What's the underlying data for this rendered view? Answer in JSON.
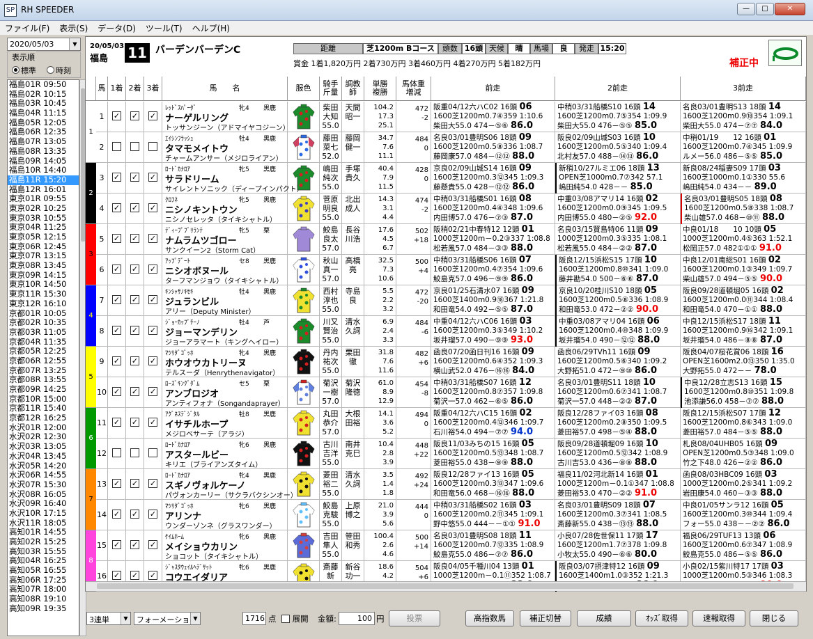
{
  "window": {
    "title": "RH SPEEDER",
    "app_icon": "SP"
  },
  "menu": [
    "ファイル(F)",
    "表示(S)",
    "データ(D)",
    "ツール(T)",
    "ヘルプ(H)"
  ],
  "sidebar": {
    "date": "2020/05/03",
    "order_label": "表示順",
    "order_std": "標準",
    "order_time": "時刻",
    "races": [
      "福島01R 09:50",
      "福島02R 10:15",
      "福島03R 10:45",
      "福島04R 11:15",
      "福島05R 12:05",
      "福島06R 12:35",
      "福島07R 13:05",
      "福島08R 13:35",
      "福島09R 14:05",
      "福島10R 14:40",
      "福島11R 15:20",
      "福島12R 16:01",
      "東京01R 09:55",
      "東京02R 10:25",
      "東京03R 10:55",
      "東京04R 11:25",
      "東京05R 12:15",
      "東京06R 12:45",
      "東京07R 13:15",
      "東京08R 13:45",
      "東京09R 14:15",
      "東京10R 14:50",
      "東京11R 15:30",
      "東京12R 16:10",
      "京都01R 10:05",
      "京都02R 10:35",
      "京都03R 11:05",
      "京都04R 11:35",
      "京都05R 12:25",
      "京都06R 12:55",
      "京都07R 13:25",
      "京都08R 13:55",
      "京都09R 14:25",
      "京都10R 15:00",
      "京都11R 15:40",
      "京都12R 16:25",
      "水沢01R 12:00",
      "水沢02R 12:30",
      "水沢03R 13:05",
      "水沢04R 13:45",
      "水沢05R 14:20",
      "水沢06R 14:55",
      "水沢07R 15:30",
      "水沢08R 16:05",
      "水沢09R 16:40",
      "水沢10R 17:15",
      "水沢11R 18:05",
      "高知01R 14:55",
      "高知02R 15:25",
      "高知03R 15:55",
      "高知04R 16:25",
      "高知05R 16:55",
      "高知06R 17:25",
      "高知07R 18:00",
      "高知08R 19:10",
      "高知09R 19:35"
    ],
    "selected_index": 10
  },
  "race": {
    "date": "20/05/03",
    "venue": "福島",
    "number": "11",
    "name": "バーデンバーデンC",
    "dist_label": "距離",
    "course": "芝1200m Bコース",
    "heads_label": "頭数",
    "heads": "16頭",
    "weather_label": "天候",
    "weather": "晴",
    "track_label": "馬場",
    "track": "良",
    "post_label": "発走",
    "post": "15:20",
    "prize": "賞金 1着1,820万円 2着730万円 3着460万円 4着270万円 5着182万円",
    "hosei": "補正中"
  },
  "columns": {
    "num": "馬",
    "c1": "1着",
    "c2": "2着",
    "c3": "3着",
    "name": "馬　　名",
    "color": "服色",
    "jockey": "騎手\n斤量",
    "trainer": "調教\n師",
    "odds": "単勝\n複勝",
    "weight": "馬体重\n増減",
    "p1": "前走",
    "p2": "2前走",
    "p3": "3前走"
  },
  "brackets": [
    {
      "n": "1",
      "color": "#ffffff",
      "fg": "#000000"
    },
    {
      "n": "2",
      "color": "#000000",
      "fg": "#ffffff"
    },
    {
      "n": "3",
      "color": "#ff0000",
      "fg": "#000000"
    },
    {
      "n": "4",
      "color": "#0000ff",
      "fg": "#ffff00"
    },
    {
      "n": "5",
      "color": "#ffff00",
      "fg": "#000000"
    },
    {
      "n": "6",
      "color": "#009900",
      "fg": "#ffffff"
    },
    {
      "n": "7",
      "color": "#ff8800",
      "fg": "#000000"
    },
    {
      "n": "8",
      "color": "#ff44dd",
      "fg": "#ffffff"
    }
  ],
  "horses": [
    {
      "no": "1",
      "c1": true,
      "c2": true,
      "c3": true,
      "sire": "ﾚｯﾄﾞｽﾊﾟｰﾀﾞ",
      "sex": "牝4",
      "hcol": "黒鹿",
      "name": "ナーゲルリング",
      "dam": "トッサンジーン（アドマイヤコジーン）",
      "jockey": "柴田\n大知\n55.0",
      "trainer": "天間\n昭一",
      "odds": "104.2\n17.3\n25.1",
      "weight": "472\n-2",
      "silk": {
        "body": "#1a8a2a",
        "pat": "#d42020",
        "sleeve": "#1a8a2a",
        "cap": "#1a8a2a"
      },
      "p1": [
        "阪重04/12六ハC02 16頭",
        "06",
        "1600芝1200m0.7④359 1:10.6",
        "柴田大55.0 474－⑤⑥",
        "86.0",
        ""
      ],
      "p2": [
        "中稍03/31船橋S10 16頭",
        "14",
        "1600芝1200m0.7⑤354 1:09.9",
        "柴田大55.0 476－⑤⑤",
        "85.0",
        ""
      ],
      "p3": [
        "名良03/01豊明S13 18頭",
        "14",
        "1600芝1200m0.9⑱354 1:09.1",
        "柴田大55.0 474－⑦⑦",
        "84.0",
        ""
      ],
      "m2": "",
      "m3": ""
    },
    {
      "no": "2",
      "c1": false,
      "c2": false,
      "c3": false,
      "sire": "ｴｲｼﾝﾌﾗｯｼｭ",
      "sex": "牡4",
      "hcol": "黒鹿",
      "name": "タマモメイトウ",
      "dam": "チャームアンサー（メジロライアン）",
      "jockey": "藤田\n菜七\n52.0",
      "trainer": "藤岡\n健一",
      "odds": "34.7\n7.6\n11.1",
      "weight": "484\n0",
      "silk": {
        "body": "#ffffff",
        "pat": "#2b6be8",
        "sleeve": "#d04060",
        "cap": "#2b6be8"
      },
      "p1": [
        "名良03/01豊明S06 18頭",
        "09",
        "1600芝1200m0.5⑧336 1:08.7",
        "藤岡康57.0 484－⑫⑫",
        "88.0",
        ""
      ],
      "p2": [
        "阪良02/09山城S03 16頭",
        "10",
        "1600芝1200m0.5⑤340 1:09.4",
        "北村友57.0 488－⑭⑬",
        "86.0",
        ""
      ],
      "p3": [
        "中稍01/19　　12 16頭",
        "01",
        "1600芝1200m0.7④345 1:09.9",
        "ルメー56.0 486－⑤⑤",
        "85.0",
        ""
      ],
      "m2": "",
      "m3": ""
    },
    {
      "no": "3",
      "c1": true,
      "c2": true,
      "c3": true,
      "sire": "ﾛｰﾄﾞｶﾅﾛｱ",
      "sex": "牝5",
      "hcol": "黒鹿",
      "name": "サラドリーム",
      "dam": "サイレントソニック（ディープインパクト）",
      "jockey": "嶋田\n純次\n55.0",
      "trainer": "手塚\n貴久",
      "odds": "40.4\n7.9\n11.5",
      "weight": "428\n0",
      "silk": {
        "body": "#1a8a2a",
        "pat": "#d42020",
        "sleeve": "#1a8a2a",
        "cap": "#1a8a2a"
      },
      "p1": [
        "京良02/09山城S14 16頭",
        "09",
        "1600芝1200m0.3⑫345 1:09.3",
        "藤懸貴55.0 428－⑫⑫",
        "86.0",
        ""
      ],
      "p2": [
        "新稍10/27ルミエ06 18頭",
        "13",
        "OPEN芝1000m0.7⑦342 57.1",
        "嶋田純54.0 428－－",
        "85.0",
        ""
      ],
      "p3": [
        "新良08/24稲妻S09 17頭",
        "03",
        "1600芝1000m0.1①330 55.6",
        "嶋田純54.0 434－－",
        "89.0",
        ""
      ],
      "m2": "mk",
      "m3": ""
    },
    {
      "no": "4",
      "c1": true,
      "c2": true,
      "c3": true,
      "sire": "ｸﾛﾌﾈ",
      "sex": "牝5",
      "hcol": "黒鹿",
      "name": "ニシノキントウン",
      "dam": "ニシノセレッタ（タイキシャトル）",
      "jockey": "菅原\n明良\n55.0",
      "trainer": "北出\n成人",
      "odds": "14.3\n3.1\n4.4",
      "weight": "474\n-2",
      "silk": {
        "body": "#f0e030",
        "pat": "#4040c0",
        "sleeve": "#f0e030",
        "cap": "#f0e030"
      },
      "p1": [
        "中稍03/31船橋S01 16頭",
        "08",
        "1600芝1200m0.4④348 1:09.6",
        "内田博57.0 476－⑦③",
        "87.0",
        ""
      ],
      "p2": [
        "中重03/08アマリ14 16頭",
        "02",
        "1600芝1200m0.0⑨345 1:09.5",
        "内田博55.0 480－②⑤",
        "92.0",
        "red"
      ],
      "p3": [
        "名良03/01豊明S05 18頭",
        "08",
        "1600芝1200m0.5⑧338 1:08.7",
        "柴山雄57.0 468－⑩⑪",
        "88.0",
        ""
      ],
      "m2": "",
      "m3": "mkr"
    },
    {
      "no": "5",
      "c1": true,
      "c2": true,
      "c3": true,
      "sire": "ﾃﾞｨｰﾌﾟﾌﾞﾘﾗﾝﾃ",
      "sex": "牝5",
      "hcol": "栗",
      "name": "ナムラムツゴロー",
      "dam": "サンクイーン2（Storm Cat）",
      "jockey": "鮫島\n良太\n57.0",
      "trainer": "長谷\n川浩",
      "odds": "17.6\n4.5\n6.7",
      "weight": "502\n+18",
      "silk": {
        "body": "#a08ad8",
        "pat": "#a08ad8",
        "sleeve": "#a08ad8",
        "cap": "#a08ad8"
      },
      "p1": [
        "阪稍02/21中春特12 12頭",
        "01",
        "1000芝1200m－0.2③337 1:08.8",
        "松若風57.0 484－③③",
        "88.0",
        ""
      ],
      "p2": [
        "名良03/15賢島特06 11頭",
        "09",
        "1000芝1200m0.3⑤335 1:08.1",
        "松若風55.0 484－②②",
        "87.0",
        ""
      ],
      "p3": [
        "中良01/18　　10 10頭",
        "05",
        "1000芝1200m0.4⑤363 1:52.1",
        "松岡正57.0 482①①①",
        "91.0",
        "red"
      ],
      "m2": "",
      "m3": ""
    },
    {
      "no": "6",
      "c1": true,
      "c2": true,
      "c3": true,
      "sire": "ｱｯﾌﾟﾃﾞｰﾄ",
      "sex": "セ8",
      "hcol": "黒鹿",
      "name": "ニシオボヌール",
      "dam": "ターフマンジョウ（タイキシャトル）",
      "jockey": "秋山\n真一\n57.0",
      "trainer": "高橋\n亮",
      "odds": "32.5\n7.3\n10.6",
      "weight": "500\n+4",
      "silk": {
        "body": "#ffffff",
        "pat": "#3050e0",
        "sleeve": "#ffffff",
        "cap": "#3050e0"
      },
      "p1": [
        "中稍03/31船橋S06 16頭",
        "07",
        "1600芝1200m0.4⑦354 1:09.6",
        "鮫島克57.0 496－⑨⑨",
        "86.0",
        ""
      ],
      "p2": [
        "阪良12/15浜松S15 17頭",
        "10",
        "1600芝1200m0.8⑩341 1:09.0",
        "藤井勘54.0 500－⑥⑥",
        "87.0",
        ""
      ],
      "p3": [
        "中良12/01南総S01 16頭",
        "02",
        "1600芝1200m0.1③349 1:09.7",
        "柴山雄57.0 494－⑤⑤",
        "90.0",
        "red"
      ],
      "m2": "mk",
      "m3": ""
    },
    {
      "no": "7",
      "c1": true,
      "c2": true,
      "c3": true,
      "sire": "ｷﾝｼｬｻﾉｷｾｷ",
      "sex": "牡4",
      "hcol": "黒鹿",
      "name": "ジュランビル",
      "dam": "アリー（Deputy Minister）",
      "jockey": "西村\n淳也\n55.0",
      "trainer": "寺島\n良",
      "odds": "5.5\n2.2\n3.2",
      "weight": "472\n-20",
      "silk": {
        "body": "#f0e030",
        "pat": "#1a8a2a",
        "sleeve": "#f0e030",
        "cap": "#1a8a2a"
      },
      "p1": [
        "京良01/25石清水07 16頭",
        "09",
        "1600芝1400m0.9⑱367 1:21.8",
        "和田竜54.0 492－⑤⑤",
        "87.0",
        ""
      ],
      "p2": [
        "京良10/20桂川S10 18頭",
        "05",
        "1600芝1200m0.5⑧336 1:08.9",
        "和田竜53.0 472－②②",
        "90.0",
        "red"
      ],
      "p3": [
        "阪良09/28道頓堀05 16頭",
        "02",
        "1600芝1200m0.0⑪344 1:08.4",
        "和田竜54.0 470－①①",
        "88.0",
        ""
      ],
      "m2": "mk",
      "m3": ""
    },
    {
      "no": "8",
      "c1": true,
      "c2": true,
      "c3": true,
      "sire": "ｼﾞｮｰｶｯﾌﾟﾁｰﾉ",
      "sex": "牡4",
      "hcol": "芦",
      "name": "ジョーマンデリン",
      "dam": "ジョーアラマート（キングヘイロー）",
      "jockey": "川又\n賢治\n55.0",
      "trainer": "清水\n久詞",
      "odds": "6.9\n2.4\n3.3",
      "weight": "484\n-6",
      "silk": {
        "body": "#1a8a2a",
        "pat": "#d42020",
        "sleeve": "#1a8a2a",
        "cap": "#1a8a2a"
      },
      "p1": [
        "中重04/12六ハC06 16頭",
        "03",
        "1600芝1200m0.3⑤349 1:10.2",
        "坂井瑠57.0 490－⑨⑨",
        "93.0",
        "red"
      ],
      "p2": [
        "中重03/08アマリ04 16頭",
        "06",
        "1600芝1200m0.4⑩348 1:09.9",
        "坂井瑠54.0 490－⑫⑫",
        "88.0",
        ""
      ],
      "p3": [
        "中良12/15浜松S17 18頭",
        "11",
        "1600芝1200m0.9⑯342 1:09.1",
        "坂井瑠54.0 486－⑧⑧",
        "87.0",
        ""
      ],
      "m2": "mk",
      "m3": ""
    },
    {
      "no": "9",
      "c1": true,
      "c2": true,
      "c3": true,
      "sire": "ﾏﾂﾘﾀﾞｺﾞｯﾎ",
      "sex": "牝4",
      "hcol": "黒鹿",
      "name": "ホウオウカトリーヌ",
      "dam": "テルスーダ（Henrythenavigator）",
      "jockey": "丹内\n祐次\n55.0",
      "trainer": "栗田\n徹",
      "odds": "31.8\n7.6\n11.6",
      "weight": "482\n+6",
      "silk": {
        "body": "#111111",
        "pat": "#d42020",
        "sleeve": "#111111",
        "cap": "#111111"
      },
      "p1": [
        "函良07/20函日刊16 16頭",
        "09",
        "1600芝1200m0.6④352 1:09.3",
        "横山武52.0 476－⑯⑯",
        "84.0",
        ""
      ],
      "p2": [
        "函良06/29TVh11 16頭",
        "09",
        "1600芝1200m0.5⑥340 1:09.2",
        "大野拓51.0 472－⑨⑩",
        "86.0",
        ""
      ],
      "p3": [
        "阪良04/07桜花賞06 18頭",
        "16",
        "OPEN芝1600m2.0⑬350 1:35.0",
        "大野拓55.0 472－－",
        "78.0",
        ""
      ],
      "m2": "",
      "m3": ""
    },
    {
      "no": "10",
      "c1": true,
      "c2": true,
      "c3": true,
      "sire": "ﾛｰｽﾞｷﾝｸﾞﾀﾞﾑ",
      "sex": "セ5",
      "hcol": "栗",
      "name": "アンブロジオ",
      "dam": "アンティフォナ（Songandaprayer）",
      "jockey": "菊沢\n一樹\n57.0",
      "trainer": "菊沢\n隆徳",
      "odds": "61.0\n8.9\n12.9",
      "weight": "454\n-8",
      "silk": {
        "body": "#ffffff",
        "pat": "#6080e0",
        "sleeve": "#6080e0",
        "cap": "#d42020"
      },
      "p1": [
        "中稍03/31船橋S07 16頭",
        "12",
        "1600芝1200m0.8⑦357 1:09.8",
        "菊沢一57.0 462－⑥⑤",
        "86.0",
        ""
      ],
      "p2": [
        "名良03/01豊明S11 18頭",
        "10",
        "1600芝1200m0.6⑦341 1:08.7",
        "菊沢一57.0 448－②②",
        "87.0",
        ""
      ],
      "p3": [
        "中良12/28立志S13 16頭",
        "15",
        "1600芝1200m0.8⑩351 1:09.8",
        "池添謙56.0 458－⑦⑦",
        "88.0",
        ""
      ],
      "m2": "",
      "m3": "mk"
    },
    {
      "no": "11",
      "c1": true,
      "c2": true,
      "c3": true,
      "sire": "ｱｸﾞﾈｽﾃﾞｼﾞﾀﾙ",
      "sex": "牡8",
      "hcol": "黒鹿",
      "name": "イサチルホープ",
      "dam": "メジロベサーテ（アラジ）",
      "jockey": "丸田\n恭介\n57.0",
      "trainer": "大根\n田裕",
      "odds": "14.1\n3.6\n5.2",
      "weight": "494\n0",
      "silk": {
        "body": "#f0e030",
        "pat": "#d42020",
        "sleeve": "#f0e030",
        "cap": "#f0e030"
      },
      "p1": [
        "阪重04/12六ハC15 16頭",
        "02",
        "1600芝1200m0.4⑬346 1:09.7",
        "石川裕54.0 494－⑦⑦",
        "94.0",
        "blue"
      ],
      "p2": [
        "阪良12/28ファイ03 16頭",
        "08",
        "1600芝1200m0.2⑧350 1:09.5",
        "菱田裕57.0 498－⑤④",
        "88.0",
        ""
      ],
      "p3": [
        "阪良12/15浜松S07 17頭",
        "12",
        "1600芝1200m0.8⑥343 1:09.0",
        "菱田裕57.0 484－⑤⑤",
        "88.0",
        ""
      ],
      "m2": "",
      "m3": ""
    },
    {
      "no": "12",
      "c1": false,
      "c2": false,
      "c3": false,
      "sire": "ﾛｰﾄﾞｶﾅﾛｱ",
      "sex": "牝6",
      "hcol": "黒鹿",
      "name": "アスタールビー",
      "dam": "キリエ（ブライアンズタイム）",
      "jockey": "古川\n吉洋\n55.0",
      "trainer": "南井\n克巳",
      "odds": "10.4\n2.8\n3.9",
      "weight": "448\n+22",
      "silk": {
        "body": "#111111",
        "pat": "#d42020",
        "sleeve": "#111111",
        "cap": "#111111"
      },
      "p1": [
        "阪良11/03みちの15 16頭",
        "05",
        "1600芝1200m0.5⑬348 1:08.7",
        "菱田裕55.0 438－⑨⑨",
        "88.0",
        ""
      ],
      "p2": [
        "阪良09/28道頓堀09 16頭",
        "10",
        "1600芝1200m0.5⑫342 1:08.9",
        "古川吉53.0 436－⑧⑧",
        "88.0",
        ""
      ],
      "p3": [
        "札良08/04UHB05 16頭",
        "09",
        "OPEN芝1200m0.5③348 1:09.0",
        "竹之下48.0 426－②②",
        "86.0",
        ""
      ],
      "m2": "",
      "m3": ""
    },
    {
      "no": "13",
      "c1": true,
      "c2": true,
      "c3": true,
      "sire": "ﾛｰﾄﾞｶﾅﾛｱ",
      "sex": "牝4",
      "hcol": "黒鹿",
      "name": "スギノヴォルケーノ",
      "dam": "パヴォンカーリー（サクラバクシンオー）",
      "jockey": "菱田\n裕二\n55.0",
      "trainer": "清水\n久詞",
      "odds": "3.5\n1.4\n1.8",
      "weight": "492\n+24",
      "silk": {
        "body": "#f0e030",
        "pat": "#111111",
        "sleeve": "#f0e030",
        "cap": "#f0e030"
      },
      "p1": [
        "阪良12/28ファイ13 16頭",
        "05",
        "1600芝1200m0.3⑬347 1:09.6",
        "和田竜56.0 468－⑯⑯",
        "88.0",
        ""
      ],
      "p2": [
        "福良11/02河北新14 16頭",
        "01",
        "1000芝1200m－0.1①347 1:08.8",
        "菱田裕53.0 470－②②",
        "91.0",
        "red"
      ],
      "p3": [
        "函良08/03HBC09 16頭",
        "03",
        "1000芝1200m0.2⑤341 1:09.2",
        "岩田康54.0 460－③③",
        "88.0",
        ""
      ],
      "m2": "",
      "m3": ""
    },
    {
      "no": "14",
      "c1": true,
      "c2": true,
      "c3": true,
      "sire": "ﾏﾂﾘﾀﾞｺﾞｯﾎ",
      "sex": "牝6",
      "hcol": "黒鹿",
      "name": "アリンナ",
      "dam": "ウンダーゾンネ（グラスワンダー）",
      "jockey": "鮫島\n克駿\n55.0",
      "trainer": "上原\n博之",
      "odds": "21.0\n3.9\n5.6",
      "weight": "444\n0",
      "silk": {
        "body": "#ffffff",
        "pat": "#60c0ff",
        "sleeve": "#ffffff",
        "cap": "#60c0ff"
      },
      "p1": [
        "中稍03/31船橋S02 16頭",
        "03",
        "1600芝1200m0.2⑪345 1:09.1",
        "野中悠55.0 444－－①①",
        "91.0",
        "red"
      ],
      "p2": [
        "名良03/01豊明S09 18頭",
        "07",
        "1600芝1200m0.3⑦341 1:08.5",
        "斎藤新55.0 438－⑬⑬",
        "88.0",
        ""
      ],
      "p3": [
        "中良01/05サンラ12 16頭",
        "05",
        "1600芝1200m0.3⑩344 1:09.4",
        "フォー55.0 438－－②②",
        "86.0",
        ""
      ],
      "m2": "",
      "m3": ""
    },
    {
      "no": "15",
      "c1": true,
      "c2": true,
      "c3": true,
      "sire": "ｹｲﾑﾎｰﾑ",
      "sex": "牝6",
      "hcol": "黒鹿",
      "name": "メイショウカリン",
      "dam": "ショコット（タイキシャトル）",
      "jockey": "吉田\n隼人\n55.0",
      "trainer": "笹田\n和秀",
      "odds": "100.4\n2.6\n4.6",
      "weight": "500\n+14",
      "silk": {
        "body": "#5b6bd8",
        "pat": "#d84040",
        "sleeve": "#5b6bd8",
        "cap": "#d84040"
      },
      "p1": [
        "名良03/01豊明S08 18頭",
        "11",
        "1600芝1200m0.7⑫335 1:08.9",
        "鮫島克55.0 486－⑦⑦",
        "86.0",
        ""
      ],
      "p2": [
        "小良07/28佐世保11 17頭",
        "17",
        "1600芝1200m1.7⑦378 1:09.8",
        "小牧太55.0 490－⑥⑥",
        "80.0",
        ""
      ],
      "p3": [
        "福良06/29TUF13 13頭",
        "06",
        "1600芝1200m0.6⑦347 1:08.9",
        "鮫島克55.0 486－⑤⑤",
        "86.0",
        ""
      ],
      "m2": "",
      "m3": ""
    },
    {
      "no": "16",
      "c1": true,
      "c2": true,
      "c3": true,
      "sire": "ｼﾞｬｽﾀｳｪｲﾙﾍﾃﾞｻｯﾄ",
      "sex": "牝6",
      "hcol": "黒鹿",
      "name": "コウエイダリア",
      "dam": "ツルマルアイ（タイキシャトル）",
      "jockey": "斎藤\n新\n55.0",
      "trainer": "新谷\n功一",
      "odds": "18.6\n4.2\n6.1",
      "weight": "504\n+6",
      "silk": {
        "body": "#f0e030",
        "pat": "#111111",
        "sleeve": "#f0e030",
        "cap": "#f0e030"
      },
      "p1": [
        "阪良04/05千種川04 13頭",
        "01",
        "1000芝1200m－0.1⑪352 1:08.7",
        "松山弘55.0 498－①①",
        "88.0",
        ""
      ],
      "p2": [
        "阪良03/07摂津特12 16頭",
        "09",
        "1600芝1400m1.0③352 1:21.3",
        "松山弘55.0 488－②③",
        "86.0",
        ""
      ],
      "p3": [
        "小良02/15紫川特17 17頭",
        "03",
        "1000芝1200m0.5③346 1:08.3",
        "松若風54.0 496－⑧⑨",
        "90.0",
        "red"
      ],
      "m2": "mk",
      "m3": ""
    }
  ],
  "bottom": {
    "bet_type": "3連単",
    "bet_mode": "フォーメーション",
    "points": "1716",
    "points_unit": "点",
    "expand": "展開",
    "amount_label": "金額:",
    "amount": "100",
    "amount_unit": "円",
    "vote": "投票",
    "b1": "高指数馬",
    "b2": "補正切替",
    "b3": "成績",
    "b4": "ｵｯｽﾞ取得",
    "b5": "速報取得",
    "b6": "閉じる"
  }
}
